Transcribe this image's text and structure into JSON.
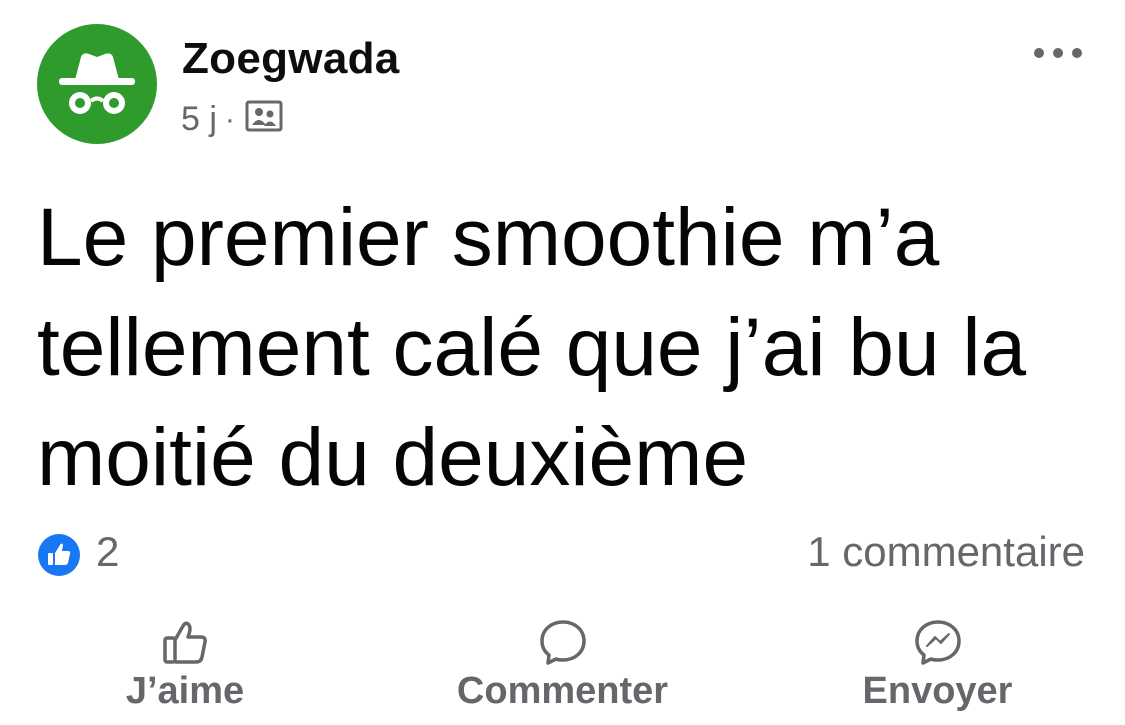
{
  "post": {
    "author": "Zoegwada",
    "time": "5 j",
    "separator": "·",
    "audience_icon": "friends-group-icon",
    "text": "Le premier smoothie m’a tellement calé que j’ai bu la moitié du deuxième",
    "reaction_icon": "like-reaction-icon",
    "reaction_count": "2",
    "comment_count": "1 commentaire"
  },
  "actions": {
    "like": "J’aime",
    "comment": "Commenter",
    "send": "Envoyer"
  },
  "colors": {
    "avatar_bg": "#2e9b2c",
    "like_blue": "#1877f2",
    "secondary_text": "#65676b"
  }
}
